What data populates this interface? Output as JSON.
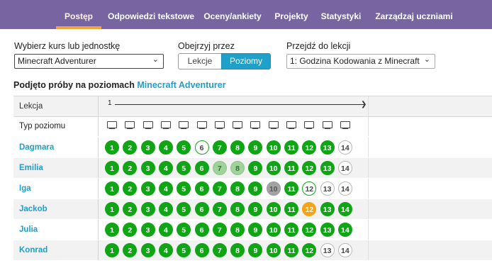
{
  "nav": {
    "tabs": [
      {
        "label": "Postęp",
        "active": true
      },
      {
        "label": "Odpowiedzi tekstowe",
        "active": false
      },
      {
        "label": "Oceny/ankiety",
        "active": false
      },
      {
        "label": "Projekty",
        "active": false
      },
      {
        "label": "Statystyki",
        "active": false
      },
      {
        "label": "Zarządzaj uczniami",
        "active": false
      }
    ]
  },
  "controls": {
    "course_label": "Wybierz kurs lub jednostkę",
    "course_value": "Minecraft Adventurer",
    "view_label": "Obejrzyj przez",
    "view_lessons": "Lekcje",
    "view_levels": "Poziomy",
    "jump_label": "Przejdź do lekcji",
    "jump_value": "1: Godzina Kodowania z Minecraft"
  },
  "heading": {
    "prefix": "Podjęto próby na poziomach",
    "course_link": "Minecraft Adventurer"
  },
  "table": {
    "lesson_label": "Lekcja",
    "lesson_number": "1",
    "level_type_label": "Typ poziomu",
    "level_count": 14,
    "students": [
      {
        "name": "Dagmara",
        "levels": [
          "done",
          "done",
          "done",
          "done",
          "done",
          "started",
          "done",
          "done",
          "done",
          "done",
          "done",
          "done",
          "done",
          "none"
        ]
      },
      {
        "name": "Emilia",
        "levels": [
          "done",
          "done",
          "done",
          "done",
          "done",
          "done",
          "partial",
          "partial",
          "done",
          "done",
          "done",
          "done",
          "done",
          "none"
        ]
      },
      {
        "name": "Iga",
        "levels": [
          "done",
          "done",
          "done",
          "done",
          "done",
          "done",
          "done",
          "done",
          "done",
          "tried",
          "done",
          "started",
          "none",
          "none"
        ]
      },
      {
        "name": "Jackob",
        "levels": [
          "done",
          "done",
          "done",
          "done",
          "done",
          "done",
          "done",
          "done",
          "done",
          "done",
          "done",
          "assessment",
          "done",
          "done"
        ]
      },
      {
        "name": "Julia",
        "levels": [
          "done",
          "done",
          "done",
          "done",
          "done",
          "done",
          "done",
          "done",
          "done",
          "done",
          "done",
          "done",
          "done",
          "done"
        ]
      },
      {
        "name": "Konrad",
        "levels": [
          "done",
          "done",
          "done",
          "done",
          "done",
          "done",
          "done",
          "done",
          "done",
          "done",
          "done",
          "done",
          "none",
          "none"
        ]
      }
    ]
  },
  "colors": {
    "nav_bg": "#7665a0",
    "nav_active_underline": "#f2a33a",
    "accent_blue": "#1fa0c8",
    "done_green": "#0fa514",
    "partial_green": "#9fd39a",
    "assessment_orange": "#f5a413"
  }
}
